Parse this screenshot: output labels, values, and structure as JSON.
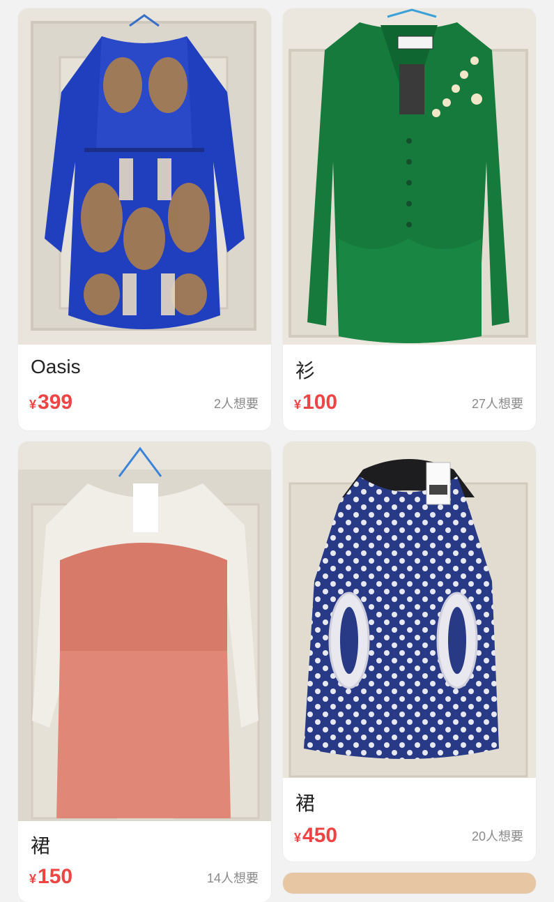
{
  "currency": "¥",
  "items": [
    {
      "title": "Oasis",
      "price": "399",
      "wants": "2人想要"
    },
    {
      "title": "衫",
      "price": "100",
      "wants": "27人想要"
    },
    {
      "title": "裙",
      "price": "150",
      "wants": "14人想要"
    },
    {
      "title": "裙",
      "price": "450",
      "wants": "20人想要"
    }
  ],
  "colors": {
    "price": "#ef4444",
    "background": "#f2f2f2",
    "card": "#ffffff"
  }
}
